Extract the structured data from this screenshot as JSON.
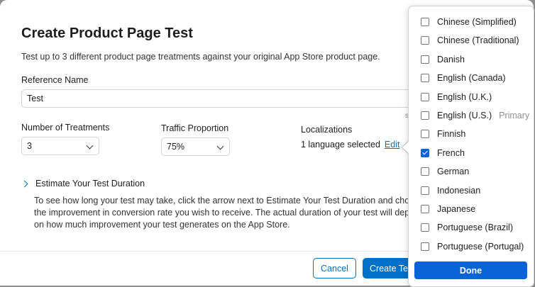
{
  "modal": {
    "title": "Create Product Page Test",
    "subtitle": "Test up to 3 different product page treatments against your original App Store product page."
  },
  "reference": {
    "label": "Reference Name",
    "value": "Test"
  },
  "treatments": {
    "label": "Number of Treatments",
    "value": "3"
  },
  "traffic": {
    "label": "Traffic Proportion",
    "value": "75%"
  },
  "localizations": {
    "label": "Localizations",
    "value": "1 language selected",
    "edit_label": "Edit"
  },
  "truncated_letter": "s",
  "estimate": {
    "toggle_label": "Estimate Your Test Duration",
    "description": "To see how long your test may take, click the arrow next to Estimate Your Test Duration and choose\nthe improvement in conversion rate you wish to receive. The actual duration of your test will depen\non how much improvement your test generates on the App Store."
  },
  "footer": {
    "cancel_label": "Cancel",
    "create_label": "Create Test"
  },
  "language_popover": {
    "languages": [
      {
        "label": "Chinese (Simplified)",
        "checked": false,
        "tag": ""
      },
      {
        "label": "Chinese (Traditional)",
        "checked": false,
        "tag": ""
      },
      {
        "label": "Danish",
        "checked": false,
        "tag": ""
      },
      {
        "label": "English (Canada)",
        "checked": false,
        "tag": ""
      },
      {
        "label": "English (U.K.)",
        "checked": false,
        "tag": ""
      },
      {
        "label": "English (U.S.)",
        "checked": false,
        "tag": "Primary"
      },
      {
        "label": "Finnish",
        "checked": false,
        "tag": ""
      },
      {
        "label": "French",
        "checked": true,
        "tag": ""
      },
      {
        "label": "German",
        "checked": false,
        "tag": ""
      },
      {
        "label": "Indonesian",
        "checked": false,
        "tag": ""
      },
      {
        "label": "Japanese",
        "checked": false,
        "tag": ""
      },
      {
        "label": "Portuguese (Brazil)",
        "checked": false,
        "tag": ""
      },
      {
        "label": "Portuguese (Portugal)",
        "checked": false,
        "tag": ""
      }
    ],
    "done_label": "Done"
  },
  "colors": {
    "accent": "#0070c9",
    "checkbox_checked": "#0a64d8",
    "overlay": "#8e8e8e"
  },
  "icons": {
    "select_arrow": "chevron-down-icon",
    "disclosure": "chevron-right-icon",
    "checkmark": "checkmark-icon"
  }
}
